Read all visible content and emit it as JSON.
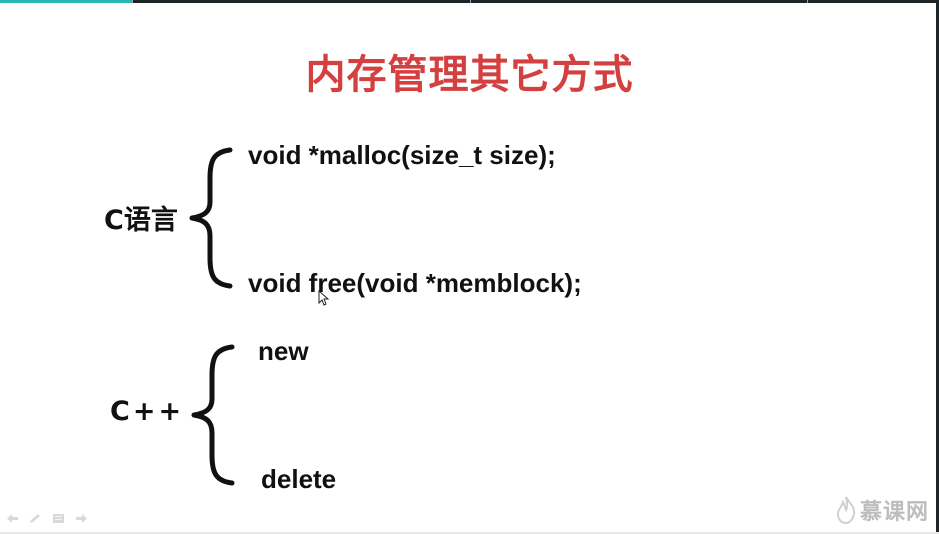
{
  "slide": {
    "title": "内存管理其它方式",
    "title_color": "#d43f3f",
    "groups": [
      {
        "label": "C语言",
        "items": [
          "void *malloc(size_t size);",
          "void free(void *memblock);"
        ]
      },
      {
        "label": "C++",
        "items": [
          "new",
          "delete"
        ]
      }
    ]
  },
  "watermark": {
    "text": "慕课网",
    "icon": "flame-logo-icon"
  },
  "toolbar": {
    "icons": [
      "prev-arrow-icon",
      "pen-icon",
      "menu-icon",
      "next-arrow-icon"
    ]
  },
  "colors": {
    "top_bar": "#1e2528",
    "top_bar_accent": "#2bb5b0",
    "watermark": "#bdbdbd"
  }
}
